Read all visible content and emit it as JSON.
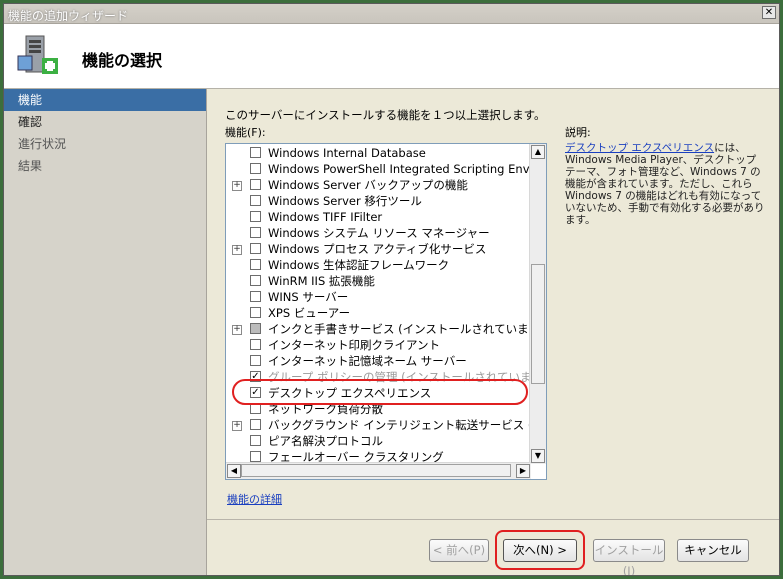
{
  "window": {
    "title": "機能の追加ウィザード",
    "close_glyph": "✕"
  },
  "header": {
    "title": "機能の選択"
  },
  "sidebar": {
    "items": [
      {
        "label": "機能"
      },
      {
        "label": "確認"
      },
      {
        "label": "進行状況"
      },
      {
        "label": "結果"
      }
    ]
  },
  "main": {
    "intro": "このサーバーにインストールする機能を１つ以上選択します。",
    "features_label": "機能(F):",
    "description_label": "説明:",
    "description_link": "デスクトップ エクスペリエンス",
    "description_body": "には、Windows Media Player、デスクトップ テーマ、フォト管理など、Windows 7 の機能が含まれています。ただし、これら Windows 7 の機能はどれも有効になっていないため、手動で有効化する必要があります。",
    "more_link": "機能の詳細",
    "features": [
      {
        "label": "Windows Internal Database",
        "expander": false,
        "state": "unchecked",
        "dim": false
      },
      {
        "label": "Windows PowerShell Integrated Scripting Environment",
        "expander": false,
        "state": "unchecked",
        "dim": false
      },
      {
        "label": "Windows Server バックアップの機能",
        "expander": true,
        "state": "unchecked",
        "dim": false
      },
      {
        "label": "Windows Server 移行ツール",
        "expander": false,
        "state": "unchecked",
        "dim": false
      },
      {
        "label": "Windows TIFF IFilter",
        "expander": false,
        "state": "unchecked",
        "dim": false
      },
      {
        "label": "Windows システム リソース マネージャー",
        "expander": false,
        "state": "unchecked",
        "dim": false
      },
      {
        "label": "Windows プロセス アクティブ化サービス",
        "expander": true,
        "state": "unchecked",
        "dim": false
      },
      {
        "label": "Windows 生体認証フレームワーク",
        "expander": false,
        "state": "unchecked",
        "dim": false
      },
      {
        "label": "WinRM IIS 拡張機能",
        "expander": false,
        "state": "unchecked",
        "dim": false
      },
      {
        "label": "WINS サーバー",
        "expander": false,
        "state": "unchecked",
        "dim": false
      },
      {
        "label": "XPS ビューアー",
        "expander": false,
        "state": "unchecked",
        "dim": false
      },
      {
        "label": "インクと手書きサービス (インストールされています)",
        "expander": true,
        "state": "partial",
        "dim": false
      },
      {
        "label": "インターネット印刷クライアント",
        "expander": false,
        "state": "unchecked",
        "dim": false
      },
      {
        "label": "インターネット記憶域ネーム サーバー",
        "expander": false,
        "state": "unchecked",
        "dim": false
      },
      {
        "label": "グループ ポリシーの管理 (インストールされています)",
        "expander": false,
        "state": "checked",
        "dim": true
      },
      {
        "label": "デスクトップ エクスペリエンス",
        "expander": false,
        "state": "checked",
        "dim": false
      },
      {
        "label": "ネットワーク負荷分散",
        "expander": false,
        "state": "unchecked",
        "dim": false
      },
      {
        "label": "バックグラウンド インテリジェント転送サービス (BITS)",
        "expander": true,
        "state": "unchecked",
        "dim": false
      },
      {
        "label": "ピア名解決プロトコル",
        "expander": false,
        "state": "unchecked",
        "dim": false
      },
      {
        "label": "フェールオーバー クラスタリング",
        "expander": false,
        "state": "unchecked",
        "dim": false
      }
    ]
  },
  "buttons": {
    "prev": "< 前へ(P)",
    "next": "次へ(N) >",
    "install": "インストール(I)",
    "cancel": "キャンセル"
  },
  "colors": {
    "highlight": "#e02020",
    "active_nav": "#3a6ea5",
    "link": "#1a3fbf"
  }
}
